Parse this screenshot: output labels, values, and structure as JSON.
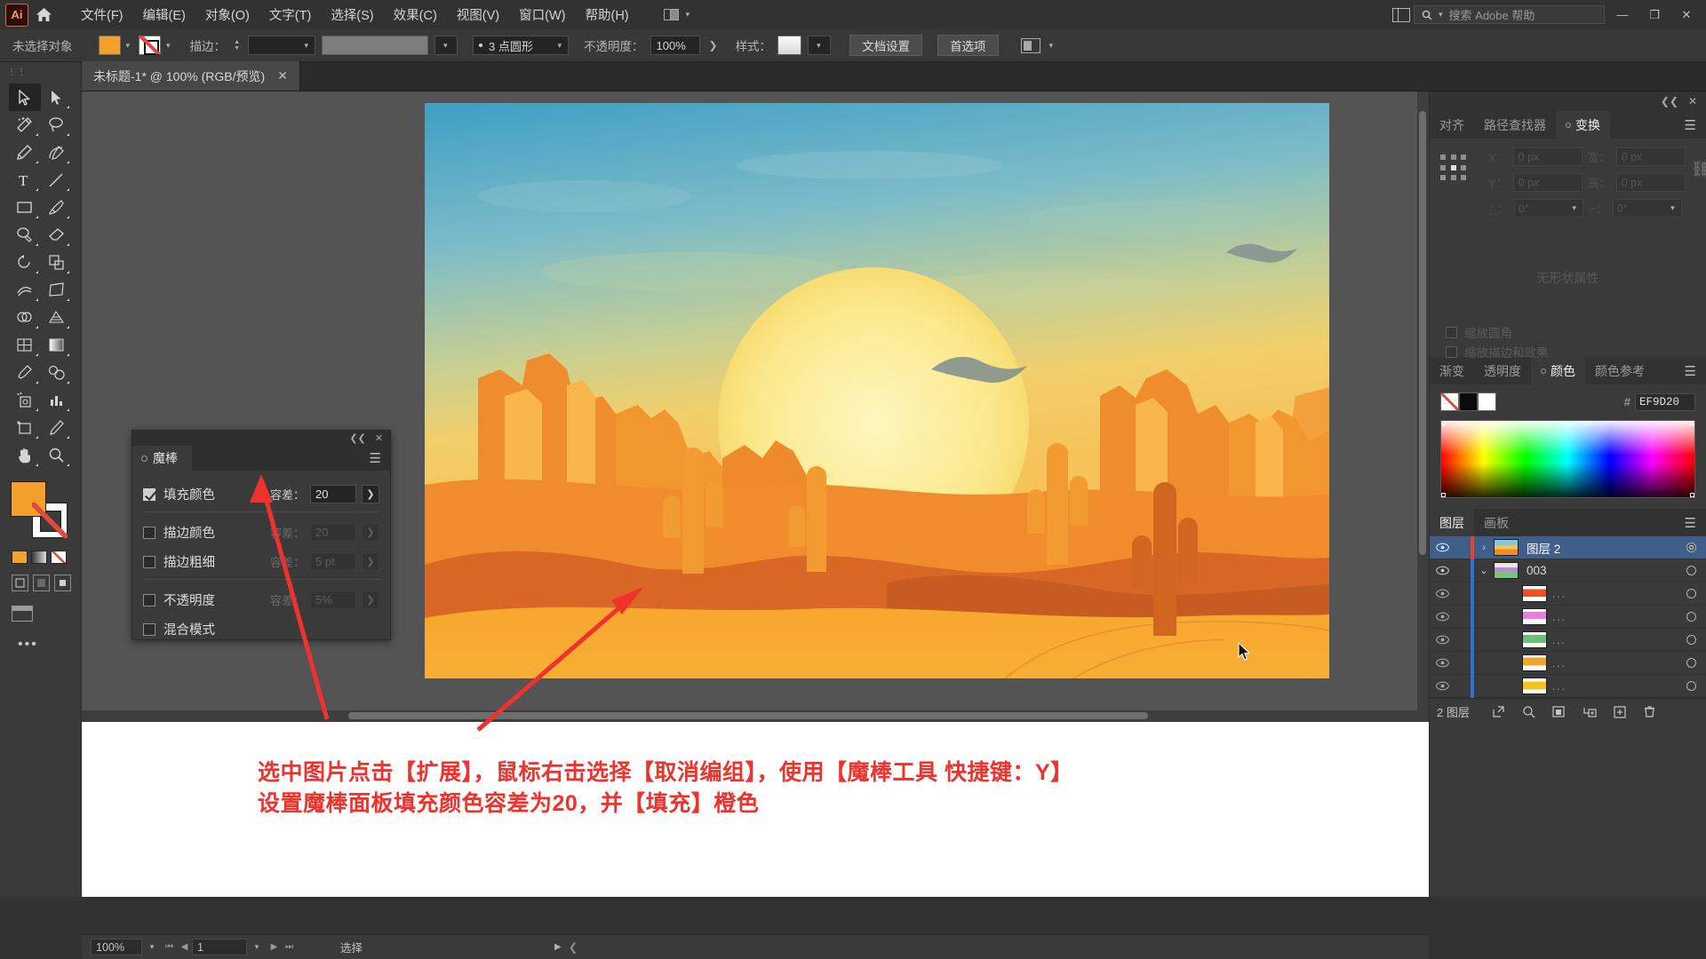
{
  "app": {
    "logo_text": "Ai",
    "menus": [
      {
        "label": "文件(F)"
      },
      {
        "label": "编辑(E)"
      },
      {
        "label": "对象(O)"
      },
      {
        "label": "文字(T)"
      },
      {
        "label": "选择(S)"
      },
      {
        "label": "效果(C)"
      },
      {
        "label": "视图(V)"
      },
      {
        "label": "窗口(W)"
      },
      {
        "label": "帮助(H)"
      }
    ],
    "search_placeholder": "搜索 Adobe 帮助",
    "window_buttons": {
      "minimize": "—",
      "maximize": "❐",
      "close": "✕"
    }
  },
  "control_bar": {
    "selection_status": "未选择对象",
    "stroke_label": "描边：",
    "stroke_weight": "",
    "stroke_profile": "",
    "brush_label": "3 点圆形",
    "opacity_label": "不透明度：",
    "opacity_value": "100%",
    "style_label": "样式：",
    "doc_setup_button": "文档设置",
    "preferences_button": "首选项"
  },
  "document_tab": {
    "title": "未标题-1* @ 100% (RGB/预览)",
    "close": "✕"
  },
  "magic_wand_panel": {
    "title": "魔棒",
    "rows": [
      {
        "label": "填充颜色",
        "checked": true,
        "tolerance_label": "容差：",
        "tolerance_value": "20",
        "enabled": true
      },
      {
        "label": "描边颜色",
        "checked": false,
        "tolerance_label": "容差：",
        "tolerance_value": "20",
        "enabled": false
      },
      {
        "label": "描边粗细",
        "checked": false,
        "tolerance_label": "容差：",
        "tolerance_value": "5 pt",
        "enabled": false
      },
      {
        "label": "不透明度",
        "checked": false,
        "tolerance_label": "容差：",
        "tolerance_value": "5%",
        "enabled": false
      },
      {
        "label": "混合模式",
        "checked": false,
        "tolerance_label": "",
        "tolerance_value": "",
        "enabled": false
      }
    ]
  },
  "transform_panel": {
    "tabs": [
      {
        "label": "对齐",
        "active": false
      },
      {
        "label": "路径查找器",
        "active": false
      },
      {
        "label": "变换",
        "active": true
      }
    ],
    "fields": {
      "x_label": "X：",
      "x_value": "0 px",
      "y_label": "Y：",
      "y_value": "0 px",
      "w_label": "宽：",
      "w_value": "0 px",
      "h_label": "高：",
      "h_value": "0 px",
      "angle_label": "△：",
      "angle_value": "0°",
      "shear_label": "⌿：",
      "shear_value": "0°"
    },
    "empty_text": "无形状属性",
    "checkboxes": [
      {
        "label": "缩放圆角"
      },
      {
        "label": "缩放描边和效果"
      }
    ]
  },
  "color_panel": {
    "tabs": [
      {
        "label": "渐变",
        "active": false
      },
      {
        "label": "透明度",
        "active": false
      },
      {
        "label": "颜色",
        "active": true
      },
      {
        "label": "颜色参考",
        "active": false
      }
    ],
    "hash_symbol": "#",
    "hex_value": "EF9D20",
    "swatches": [
      "none",
      "black",
      "white"
    ]
  },
  "layers_panel": {
    "tabs": [
      {
        "label": "图层",
        "active": true
      },
      {
        "label": "画板",
        "active": false
      }
    ],
    "rows": [
      {
        "name": "图层 2",
        "selected": true,
        "indent": 0,
        "has_twirl": true,
        "twirl": "›",
        "thumb_colors": [
          "#7fb8cf",
          "#f5b63a",
          "#ea7a22"
        ],
        "color_bar": "#e8432a",
        "dots": ""
      },
      {
        "name": "003",
        "selected": false,
        "indent": 1,
        "has_twirl": true,
        "twirl": "⌄",
        "thumb_colors": [
          "#efe9d6",
          "#b48ed8",
          "#7bc47f"
        ],
        "color_bar": "#2f6fd0",
        "dots": ""
      },
      {
        "name": "",
        "selected": false,
        "indent": 2,
        "has_twirl": false,
        "twirl": "",
        "thumb_colors": [
          "#ffffff",
          "#f04e23",
          "#ffffff"
        ],
        "color_bar": "#2f6fd0",
        "dots": "..."
      },
      {
        "name": "",
        "selected": false,
        "indent": 2,
        "has_twirl": false,
        "twirl": "",
        "thumb_colors": [
          "#ffffff",
          "#f07ae0",
          "#ffffff"
        ],
        "color_bar": "#2f6fd0",
        "dots": "..."
      },
      {
        "name": "",
        "selected": false,
        "indent": 2,
        "has_twirl": false,
        "twirl": "",
        "thumb_colors": [
          "#ffffff",
          "#6abf7a",
          "#ffffff"
        ],
        "color_bar": "#2f6fd0",
        "dots": "..."
      },
      {
        "name": "",
        "selected": false,
        "indent": 2,
        "has_twirl": false,
        "twirl": "",
        "thumb_colors": [
          "#ffffff",
          "#f0a62a",
          "#ffffff"
        ],
        "color_bar": "#2f6fd0",
        "dots": "..."
      },
      {
        "name": "",
        "selected": false,
        "indent": 2,
        "has_twirl": false,
        "twirl": "",
        "thumb_colors": [
          "#ffffff",
          "#f5c31e",
          "#ffffff"
        ],
        "color_bar": "#2f6fd0",
        "dots": "..."
      }
    ],
    "footer_count": "2 图层"
  },
  "annotation": {
    "line1": "选中图片点击【扩展】，鼠标右击选择【取消编组】，使用【魔棒工具 快捷键：Y】",
    "line2": "设置魔棒面板填充颜色容差为20，并【填充】橙色",
    "color": "#f0322c"
  },
  "status_bar": {
    "zoom": "100%",
    "page": "1",
    "tool": "选择"
  },
  "colors": {
    "fill": "#EF9D20",
    "accent_selected": "#3f5f8a",
    "annotation_red": "#f0322c",
    "panel_bg": "#3a3a3a",
    "canvas_bg": "#545454"
  },
  "toolbar_icons": [
    "selection-tool",
    "direct-selection-tool",
    "magic-wand-tool",
    "lasso-tool",
    "pen-tool",
    "curvature-tool",
    "type-tool",
    "line-tool",
    "rectangle-tool",
    "paintbrush-tool",
    "shaper-tool",
    "eraser-tool",
    "rotate-tool",
    "scale-tool",
    "width-tool",
    "free-transform-tool",
    "shape-builder-tool",
    "perspective-grid-tool",
    "mesh-tool",
    "gradient-tool",
    "eyedropper-tool",
    "blend-tool",
    "symbol-sprayer-tool",
    "column-graph-tool",
    "artboard-tool",
    "slice-tool",
    "hand-tool",
    "zoom-tool"
  ]
}
